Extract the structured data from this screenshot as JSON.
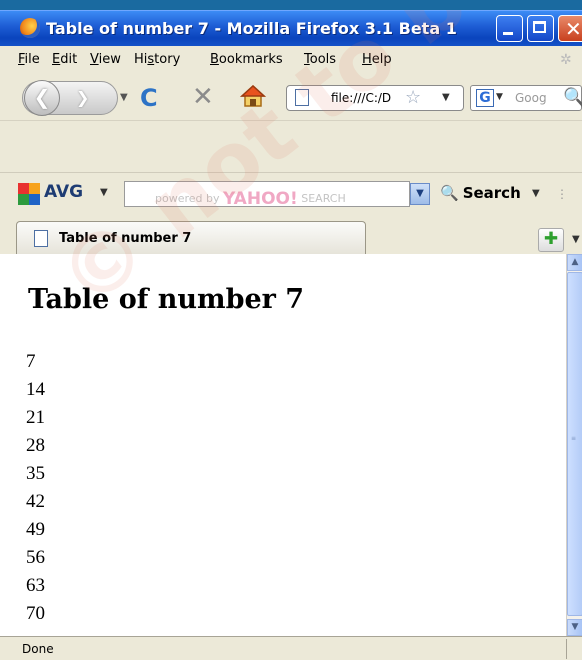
{
  "window": {
    "title": "Table of number 7 - Mozilla Firefox 3.1 Beta 1",
    "buttons": {
      "minimize": "minimize",
      "maximize": "maximize",
      "close": "✕"
    }
  },
  "menubar": {
    "items": [
      {
        "label": "File",
        "access_key": "F"
      },
      {
        "label": "Edit",
        "access_key": "E"
      },
      {
        "label": "View",
        "access_key": "V"
      },
      {
        "label": "History",
        "access_key": "s"
      },
      {
        "label": "Bookmarks",
        "access_key": "B"
      },
      {
        "label": "Tools",
        "access_key": "T"
      },
      {
        "label": "Help",
        "access_key": "H"
      }
    ]
  },
  "navbar": {
    "back_glyph": "❮",
    "forward_glyph": "❯",
    "reload_glyph": "C",
    "stop_glyph": "✕",
    "url": "file:///C:/D",
    "search_engine_glyph": "G",
    "search_placeholder": "Goog"
  },
  "avg_toolbar": {
    "brand": "AVG",
    "powered_by": "powered by",
    "yahoo_brand": "YAHOO!",
    "yahoo_search": "SEARCH",
    "search_button": "Search"
  },
  "tabs": [
    {
      "label": "Table of number 7",
      "active": true
    }
  ],
  "page": {
    "heading": "Table of number 7",
    "numbers": [
      "7",
      "14",
      "21",
      "28",
      "35",
      "42",
      "49",
      "56",
      "63",
      "70"
    ]
  },
  "statusbar": {
    "text": "Done"
  },
  "watermark": {
    "text": "© not to be republished"
  },
  "colors": {
    "titlebar": "#0a44bd",
    "chrome": "#ece9d8",
    "content_bg": "#ffffff",
    "avg_logo": [
      "#e8312f",
      "#f7a21b",
      "#2d9a3e",
      "#1f63c6"
    ]
  },
  "icons": {
    "app": "firefox-icon",
    "home": "home-icon",
    "bookmark": "star-icon",
    "page": "page-icon",
    "new_tab": "plus-icon"
  }
}
